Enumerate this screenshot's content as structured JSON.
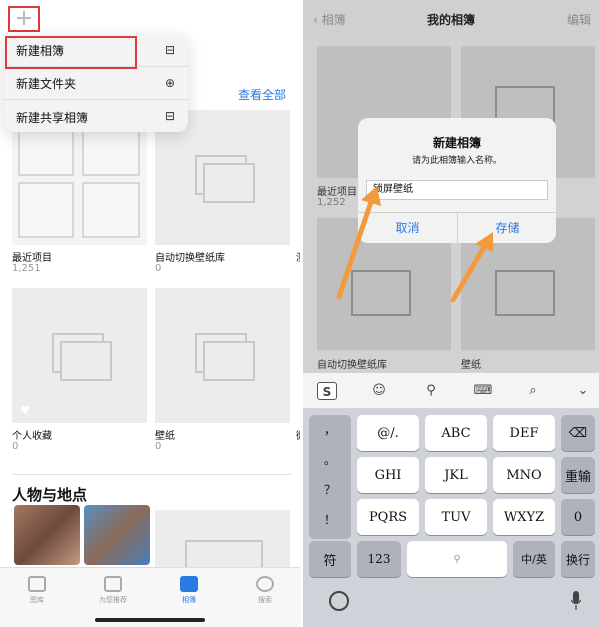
{
  "left": {
    "plus_icon": "+",
    "see_all": "查看全部",
    "menu": [
      {
        "label": "新建相簿",
        "icon": "album-stack-icon",
        "glyph": "⊟"
      },
      {
        "label": "新建文件夹",
        "icon": "folder-plus-icon",
        "glyph": "⊕"
      },
      {
        "label": "新建共享相簿",
        "icon": "shared-album-icon",
        "glyph": "⊟"
      }
    ],
    "albums": [
      {
        "name": "最近项目",
        "count": "1,251"
      },
      {
        "name": "自动切换壁纸库",
        "count": "0"
      },
      {
        "name": "个人收藏",
        "count": "0"
      },
      {
        "name": "壁纸",
        "count": "0"
      }
    ],
    "partial_labels": [
      "测",
      "微"
    ],
    "section_title": "人物与地点",
    "tabs": [
      {
        "label": "图库",
        "icon": "photo-library-icon"
      },
      {
        "label": "为您推荐",
        "icon": "for-you-icon"
      },
      {
        "label": "相簿",
        "icon": "albums-icon"
      },
      {
        "label": "搜索",
        "icon": "search-icon"
      }
    ]
  },
  "right": {
    "back_label": "相簿",
    "nav_title": "我的相簿",
    "edit_label": "编辑",
    "bg_labels": {
      "recent": "最近项目",
      "recent_count": "1,252",
      "auto": "自动切换壁纸库",
      "wallpaper": "壁纸"
    },
    "dialog": {
      "title": "新建相簿",
      "message": "请为此相簿输入名称。",
      "input_value": "锁屏壁纸",
      "cancel": "取消",
      "save": "存储"
    },
    "keyboard": {
      "side_keys": [
        "，",
        "。",
        "？",
        "！"
      ],
      "row1": [
        "@/.",
        "ABC",
        "DEF"
      ],
      "row2": [
        "GHI",
        "JKL",
        "MNO"
      ],
      "row3": [
        "PQRS",
        "TUV",
        "WXYZ"
      ],
      "right_keys": [
        "重输",
        "0"
      ],
      "bottom": {
        "symbols": "符",
        "numbers": "123",
        "lang": "中/英",
        "return": "换行"
      },
      "sogou": "S"
    }
  },
  "colors": {
    "accent": "#2a7ae4",
    "highlight": "#e0393b",
    "arrow": "#f39a3c"
  }
}
